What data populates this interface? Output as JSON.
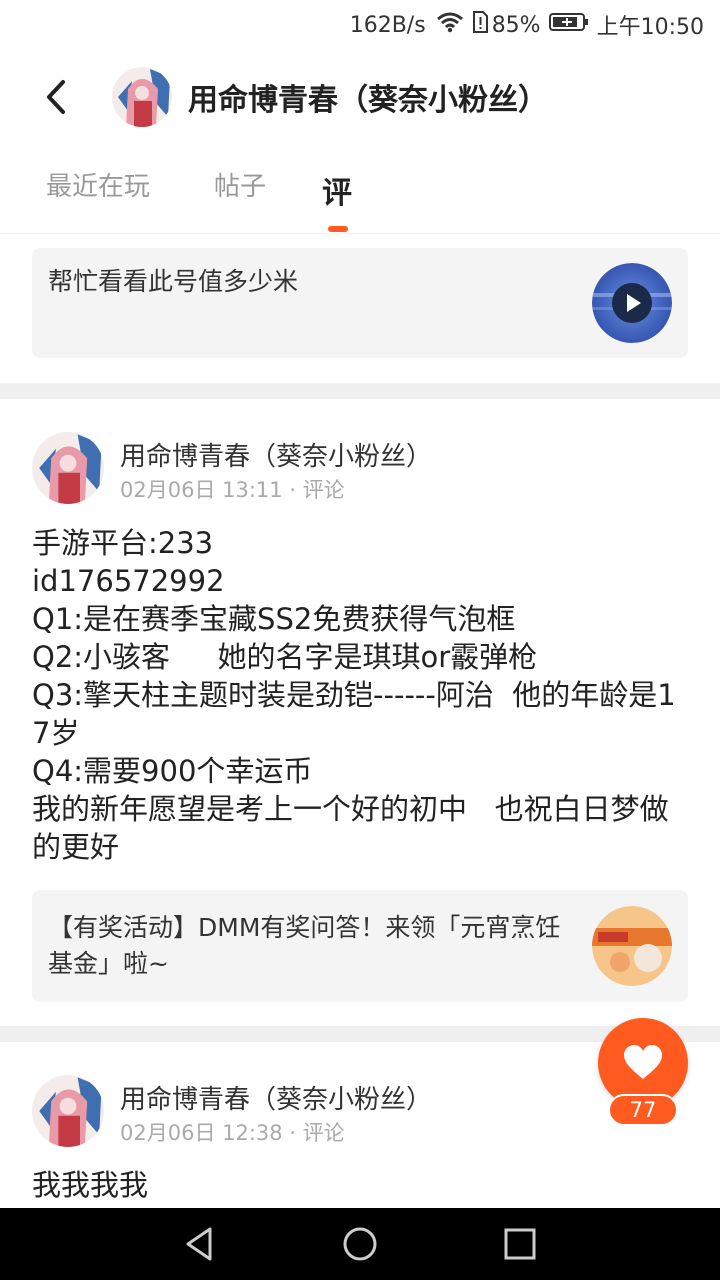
{
  "status_bar": {
    "net_speed": "162B/s",
    "battery_percent": "85%",
    "time": "上午10:50"
  },
  "header": {
    "title": "用命博青春（葵奈小粉丝）",
    "back_icon": "chevron-left-icon"
  },
  "tabs": [
    {
      "label": "最近在玩",
      "active": false
    },
    {
      "label": "帖子",
      "active": false
    },
    {
      "label": "评",
      "active": true
    }
  ],
  "quoted_video": {
    "text": "帮忙看看此号值多少米",
    "thumb_icon": "play-icon"
  },
  "posts": [
    {
      "author": "用命博青春（葵奈小粉丝）",
      "date": "02月06日 13:11",
      "type": "评论",
      "body": "手游平台:233\nid176572992\nQ1:是在赛季宝藏SS2免费获得气泡框\nQ2:小骇客　  她的名字是琪琪or霰弹枪\nQ3:擎天柱主题时装是劲铠------阿治  他的年龄是17岁\nQ4:需要900个幸运币\n我的新年愿望是考上一个好的初中   也祝白日梦做的更好",
      "quote": "【有奖活动】DMM有奖问答！来领「元宵烹饪基金」啦~"
    },
    {
      "author": "用命博青春（葵奈小粉丝）",
      "date": "02月06日 12:38",
      "type": "评论",
      "body": "我我我我"
    }
  ],
  "like": {
    "count": "77",
    "icon": "heart-icon"
  },
  "nav": {
    "back_icon": "triangle-back-icon",
    "home_icon": "circle-home-icon",
    "recents_icon": "square-recents-icon"
  },
  "colors": {
    "accent": "#ff5a1f",
    "divider": "#f0f0f0",
    "card_bg": "#f4f4f4"
  }
}
